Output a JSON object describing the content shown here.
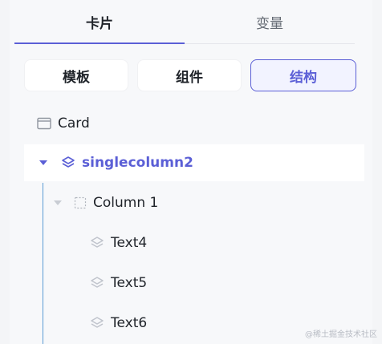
{
  "tabs": {
    "card": "卡片",
    "variables": "变量"
  },
  "segments": {
    "template": "模板",
    "component": "组件",
    "structure": "结构"
  },
  "tree": {
    "card": "Card",
    "singlecolumn": "singlecolumn2",
    "column": "Column 1",
    "items": [
      "Text4",
      "Text5",
      "Text6"
    ]
  },
  "colors": {
    "accent": "#5b5fd6",
    "guide_line": "#5b9bd5"
  },
  "watermark": "@稀土掘金技术社区"
}
